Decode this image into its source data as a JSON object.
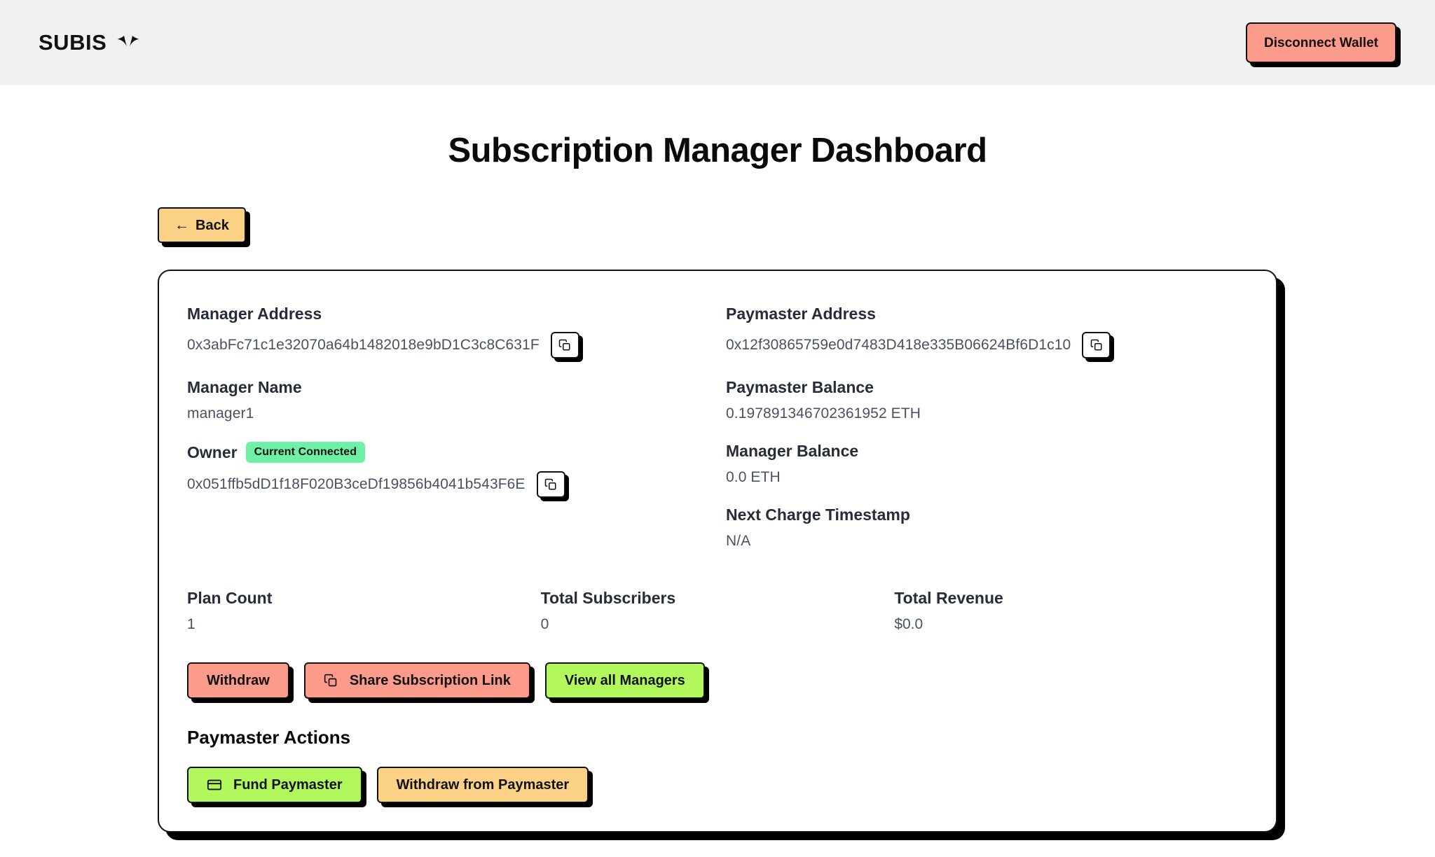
{
  "header": {
    "brand": "SUBIS",
    "brand_icon": "wings-icon",
    "disconnect_label": "Disconnect Wallet",
    "background": "#f1f1f1"
  },
  "page": {
    "title": "Subscription Manager Dashboard",
    "back_label": "Back",
    "back_arrow": "←"
  },
  "card": {
    "left": {
      "manager_address": {
        "label": "Manager Address",
        "value": "0x3abFc71c1e32070a64b1482018e9bD1C3c8C631F",
        "copy_icon": "copy-icon"
      },
      "manager_name": {
        "label": "Manager Name",
        "value": "manager1"
      },
      "owner": {
        "label": "Owner",
        "badge": "Current Connected",
        "badge_color": "#6ff0a7",
        "value": "0x051ffb5dD1f18F020B3ceDf19856b4041b543F6E",
        "copy_icon": "copy-icon"
      }
    },
    "right": {
      "paymaster_address": {
        "label": "Paymaster Address",
        "value": "0x12f30865759e0d7483D418e335B06624Bf6D1c10",
        "copy_icon": "copy-icon"
      },
      "paymaster_balance": {
        "label": "Paymaster Balance",
        "value": "0.197891346702361952 ETH"
      },
      "manager_balance": {
        "label": "Manager Balance",
        "value": "0.0 ETH"
      },
      "next_charge": {
        "label": "Next Charge Timestamp",
        "value": "N/A"
      }
    },
    "stats": [
      {
        "label": "Plan Count",
        "value": "1"
      },
      {
        "label": "Total Subscribers",
        "value": "0"
      },
      {
        "label": "Total Revenue",
        "value": "$0.0"
      }
    ],
    "actions": [
      {
        "label": "Withdraw",
        "color": "#fb9b8c"
      },
      {
        "label": "Share Subscription Link",
        "color": "#fb9b8c",
        "icon": "copy-icon"
      },
      {
        "label": "View all Managers",
        "color": "#b2f75c"
      }
    ],
    "paymaster_section": {
      "title": "Paymaster Actions",
      "buttons": [
        {
          "label": "Fund Paymaster",
          "color": "#b2f75c",
          "icon": "credit-card-icon"
        },
        {
          "label": "Withdraw from Paymaster",
          "color": "#fbd285"
        }
      ]
    }
  }
}
